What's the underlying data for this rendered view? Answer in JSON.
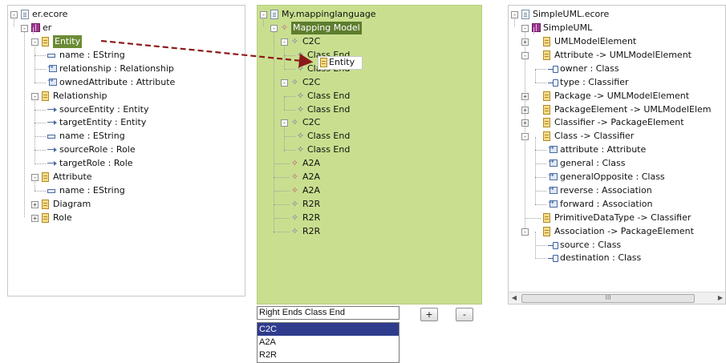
{
  "left_tree": {
    "root": "er.ecore",
    "package": "er",
    "rows": [
      {
        "label": "Entity",
        "kind": "class"
      },
      {
        "label": "name : EString",
        "kind": "attr"
      },
      {
        "label": "relationship : Relationship",
        "kind": "ref"
      },
      {
        "label": "ownedAttribute : Attribute",
        "kind": "ref"
      },
      {
        "label": "Relationship",
        "kind": "class"
      },
      {
        "label": "sourceEntity : Entity",
        "kind": "oref"
      },
      {
        "label": "targetEntity : Entity",
        "kind": "oref"
      },
      {
        "label": "name : EString",
        "kind": "attr"
      },
      {
        "label": "sourceRole : Role",
        "kind": "oref"
      },
      {
        "label": "targetRole : Role",
        "kind": "oref"
      },
      {
        "label": "Attribute",
        "kind": "class"
      },
      {
        "label": "name : EString",
        "kind": "attr"
      },
      {
        "label": "Diagram",
        "kind": "class"
      },
      {
        "label": "Role",
        "kind": "class"
      }
    ]
  },
  "mid_tree": {
    "root": "My.mappinglanguage",
    "model": "Mapping Model",
    "rows": [
      {
        "label": "C2C"
      },
      {
        "label": "Class End"
      },
      {
        "label": "Class End"
      },
      {
        "label": "C2C"
      },
      {
        "label": "Class End"
      },
      {
        "label": "Class End"
      },
      {
        "label": "C2C"
      },
      {
        "label": "Class End"
      },
      {
        "label": "Class End"
      },
      {
        "label": "A2A"
      },
      {
        "label": "A2A"
      },
      {
        "label": "A2A"
      },
      {
        "label": "R2R"
      },
      {
        "label": "R2R"
      },
      {
        "label": "R2R"
      }
    ],
    "drag_label": "Entity"
  },
  "right_tree": {
    "root": "SimpleUML.ecore",
    "package": "SimpleUML",
    "rows": [
      {
        "label": "UMLModelElement"
      },
      {
        "label": "Attribute -> UMLModelElement"
      },
      {
        "label": "owner : Class"
      },
      {
        "label": "type : Classifier"
      },
      {
        "label": "Package -> UMLModelElement"
      },
      {
        "label": "PackageElement -> UMLModelElem"
      },
      {
        "label": "Classifier -> PackageElement"
      },
      {
        "label": "Class -> Classifier"
      },
      {
        "label": "attribute : Attribute"
      },
      {
        "label": "general : Class"
      },
      {
        "label": "generalOpposite : Class"
      },
      {
        "label": "reverse : Association"
      },
      {
        "label": "forward : Association"
      },
      {
        "label": "PrimitiveDataType -> Classifier"
      },
      {
        "label": "Association -> PackageElement"
      },
      {
        "label": "source : Class"
      },
      {
        "label": "destination : Class"
      }
    ],
    "scroll_thumb": "III"
  },
  "controls": {
    "field_value": "Right Ends Class End",
    "add_label": "+",
    "remove_label": "-",
    "options": [
      "C2C",
      "A2A",
      "R2R"
    ],
    "selected_option": "C2C"
  },
  "colors": {
    "mapping_bg": "#c9df8f",
    "selection": "#5e7d2e",
    "list_selection": "#2f3b8c",
    "drag_arrow": "#8b1a1a"
  }
}
